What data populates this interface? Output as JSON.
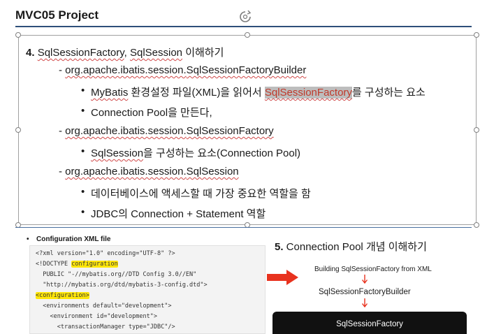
{
  "slide": {
    "title": "MVC05 Project"
  },
  "section4": {
    "num": "4.",
    "t_a": "SqlSessionFactory",
    "t_b": ", ",
    "t_c": "SqlSession",
    "t_d": " 이해하기",
    "items": [
      {
        "prefix": "- ",
        "pkg": "org.apache.ibatis.session.",
        "cls": "SqlSessionFactoryBuilder"
      },
      {
        "a": "MyBatis",
        "b": " 환경설정 파일(XML)을 읽어서 ",
        "c": "SqlSessionFactory",
        "d": "를 구성하는 요소"
      },
      {
        "text": "Connection Pool을 만든다,"
      },
      {
        "prefix": "- ",
        "pkg": "org.apache.ibatis.session.",
        "cls": "SqlSessionFactory"
      },
      {
        "a": "SqlSession",
        "b": "을 구성하는 요소(Connection Pool)"
      },
      {
        "prefix": "- ",
        "pkg": "org.apache.ibatis.session.",
        "cls": "SqlSession"
      },
      {
        "text": "데이터베이스에 액세스할 때 가장 중요한 역할을 함"
      },
      {
        "text": "JDBC의 Connection + Statement 역할"
      }
    ]
  },
  "config": {
    "label": "Configuration XML file",
    "code": {
      "l1": "<?xml version=\"1.0\" encoding=\"UTF-8\" ?>",
      "l2a": "<!DOCTYPE ",
      "l2b": "configuration",
      "l3": "  PUBLIC \"-//mybatis.org//DTD Config 3.0//EN\"",
      "l4": "  \"http://mybatis.org/dtd/mybatis-3-config.dtd\">",
      "l5": "<configuration>",
      "l6": "  <environments default=\"development\">",
      "l7": "    <environment id=\"development\">",
      "l8": "      <transactionManager type=\"JDBC\"/>"
    }
  },
  "section5": {
    "num": "5.",
    "title_a": " Connection Pool ",
    "title_b": "개념 이해하기",
    "flow": {
      "step1": "Building SqlSessionFactory from XML",
      "step2": "SqlSessionFactoryBuilder",
      "step3": "SqlSessionFactory"
    }
  },
  "colors": {
    "title_rule": "#2e4f7a",
    "highlight_yellow": "#ffe60a",
    "arrow_red": "#e8321e",
    "spell_underline": "#d04848",
    "factory_box": "#111111"
  },
  "icons": {
    "rotate": "rotate-handle-icon",
    "arrow": "right-arrow-icon"
  }
}
